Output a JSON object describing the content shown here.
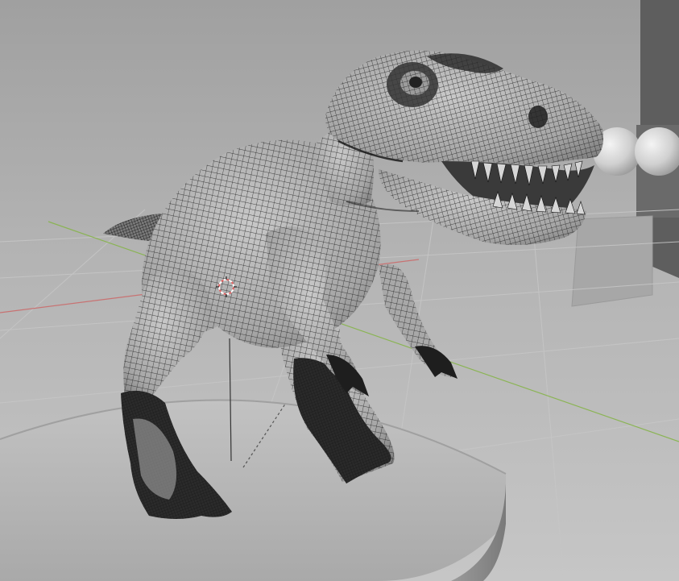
{
  "viewport": {
    "mode": "3d-viewport",
    "shading": "wireframe-overlay-on-solid",
    "subject": "t-rex-mesh"
  },
  "colors": {
    "background_top": "#a3a3a3",
    "background_bottom": "#bdbdbd",
    "grid_line": "#c4c4c4",
    "axis_x": "#c86a6a",
    "axis_y": "#7fae3a",
    "pedestal": "#b8b8b8",
    "pedestal_edge": "#8e8e8e",
    "mesh_fill": "#b3b3b3",
    "mesh_wire": "#1b1b1b",
    "dark_wall": "#5a5a5a",
    "sphere": "#d9d9d9",
    "cursor": "#e06060"
  }
}
